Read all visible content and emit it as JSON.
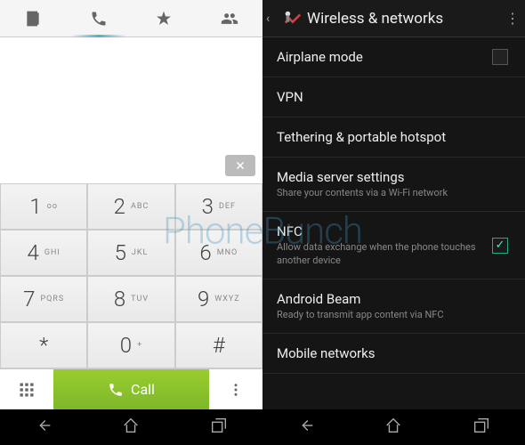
{
  "watermark": "PhoneBunch",
  "dialer": {
    "keys": [
      {
        "num": "1",
        "sub": "oo"
      },
      {
        "num": "2",
        "sub": "ABC"
      },
      {
        "num": "3",
        "sub": "DEF"
      },
      {
        "num": "4",
        "sub": "GHI"
      },
      {
        "num": "5",
        "sub": "JKL"
      },
      {
        "num": "6",
        "sub": "MNO"
      },
      {
        "num": "7",
        "sub": "PQRS"
      },
      {
        "num": "8",
        "sub": "TUV"
      },
      {
        "num": "9",
        "sub": "WXYZ"
      },
      {
        "num": "*",
        "sub": ""
      },
      {
        "num": "0",
        "sub": "+"
      },
      {
        "num": "#",
        "sub": ""
      }
    ],
    "call_label": "Call"
  },
  "settings": {
    "title": "Wireless & networks",
    "items": [
      {
        "primary": "Airplane mode",
        "secondary": "",
        "widget": "checkbox-empty"
      },
      {
        "primary": "VPN",
        "secondary": "",
        "widget": ""
      },
      {
        "primary": "Tethering & portable hotspot",
        "secondary": "",
        "widget": ""
      },
      {
        "primary": "Media server settings",
        "secondary": "Share your contents via a Wi-Fi network",
        "widget": ""
      },
      {
        "primary": "NFC",
        "secondary": "Allow data exchange when the phone touches another device",
        "widget": "checkbox-checked"
      },
      {
        "primary": "Android Beam",
        "secondary": "Ready to transmit app content via NFC",
        "widget": ""
      },
      {
        "primary": "Mobile networks",
        "secondary": "",
        "widget": ""
      }
    ]
  }
}
